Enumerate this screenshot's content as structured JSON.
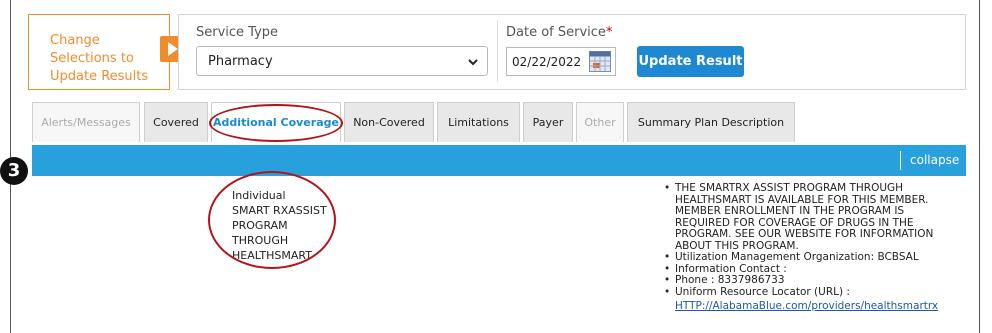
{
  "change_panel": {
    "text": "Change Selections to Update Results"
  },
  "filters": {
    "service_type_label": "Service Type",
    "service_type_value": "Pharmacy",
    "date_label": "Date of Service",
    "date_required": "*",
    "date_value": "02/22/2022",
    "update_button": "Update Result"
  },
  "tabs": [
    {
      "label": "Alerts/Messages",
      "state": "disabled"
    },
    {
      "label": "Covered",
      "state": "normal"
    },
    {
      "label": "Additional Coverage",
      "state": "active"
    },
    {
      "label": "Non-Covered",
      "state": "normal"
    },
    {
      "label": "Limitations",
      "state": "normal"
    },
    {
      "label": "Payer",
      "state": "normal"
    },
    {
      "label": "Other",
      "state": "disabled"
    },
    {
      "label": "Summary Plan Description",
      "state": "normal"
    }
  ],
  "section_bar": {
    "collapse_label": "collapse"
  },
  "step_marker": "3",
  "coverage": {
    "left_lines": [
      "Individual",
      "SMART RXASSIST",
      "PROGRAM",
      "THROUGH",
      "HEALTHSMART"
    ],
    "details": [
      {
        "lines": [
          "THE SMARTRX ASSIST PROGRAM THROUGH",
          "HEALTHSMART IS AVAILABLE FOR THIS MEMBER.",
          "MEMBER ENROLLMENT IN THE PROGRAM IS",
          "REQUIRED FOR COVERAGE OF DRUGS IN THE",
          "PROGRAM. SEE OUR WEBSITE FOR INFORMATION",
          "ABOUT THIS PROGRAM."
        ]
      },
      {
        "lines": [
          "Utilization Management Organization: BCBSAL"
        ]
      },
      {
        "lines": [
          "Information Contact :"
        ]
      },
      {
        "lines": [
          "Phone : 8337986733"
        ]
      },
      {
        "lines": [
          "Uniform Resource Locator (URL) :"
        ],
        "link": "HTTP://AlabamaBlue.com/providers/healthsmartrx"
      }
    ]
  },
  "colors": {
    "accent_orange": "#f08c2a",
    "primary_blue": "#1e88d2",
    "bar_blue": "#27a0dc",
    "annotation_red": "#b3141b"
  }
}
